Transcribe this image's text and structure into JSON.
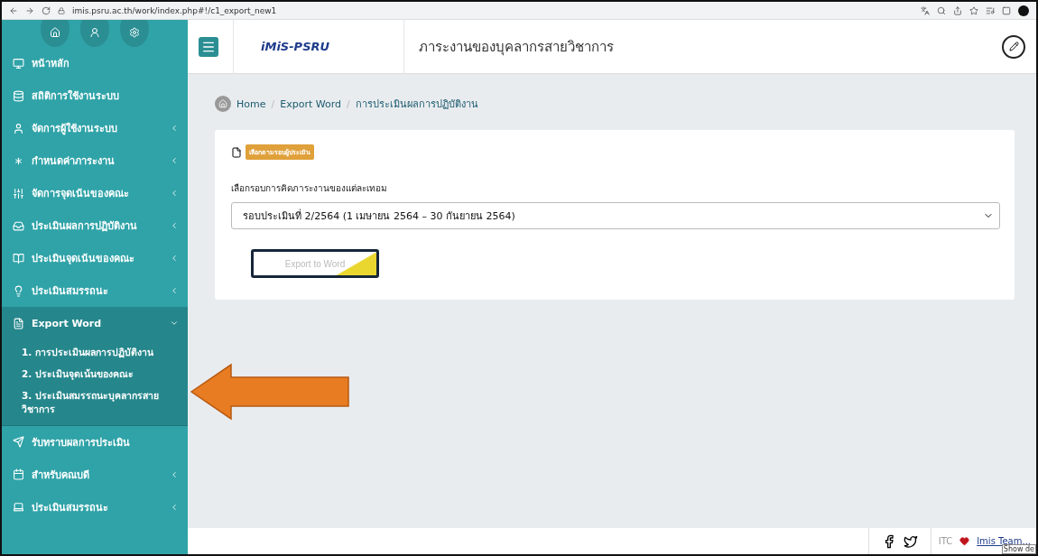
{
  "browser": {
    "url": "imis.psru.ac.th/work/index.php#!/c1_export_new1"
  },
  "sidebar": {
    "items": [
      {
        "label": "หน้าหลัก",
        "kind": "link"
      },
      {
        "label": "สถิติการใช้งานระบบ",
        "kind": "link"
      },
      {
        "label": "จัดการผู้ใช้งานระบบ",
        "kind": "menu",
        "expanded": false
      },
      {
        "label": "กำหนดค่าภาระงาน",
        "kind": "menu",
        "expanded": false
      },
      {
        "label": "จัดการจุดเน้นของคณะ",
        "kind": "menu",
        "expanded": false
      },
      {
        "label": "ประเมินผลการปฏิบัติงาน",
        "kind": "menu",
        "expanded": false
      },
      {
        "label": "ประเมินจุดเน้นของคณะ",
        "kind": "menu",
        "expanded": false
      },
      {
        "label": "ประเมินสมรรถนะ",
        "kind": "menu",
        "expanded": false
      },
      {
        "label": "Export Word",
        "kind": "menu",
        "expanded": true,
        "children": [
          {
            "label": "1. การประเมินผลการปฏิบัติงาน"
          },
          {
            "label": "2. ประเมินจุดเน้นของคณะ"
          },
          {
            "label": "3. ประเมินสมรรถนะบุคลากรสายวิชาการ"
          }
        ]
      },
      {
        "label": "รับทราบผลการประเมิน",
        "kind": "link"
      },
      {
        "label": "สำหรับคณบดี",
        "kind": "menu",
        "expanded": false
      },
      {
        "label": "ประเมินสมรรถนะ",
        "kind": "menu",
        "expanded": false
      }
    ]
  },
  "header": {
    "logo": "iMiS-PSRU",
    "title": "ภาระงานของบุคลากรสายวิชาการ"
  },
  "breadcrumb": {
    "separator": "/",
    "items": [
      "Home",
      "Export Word",
      "การประเมินผลการปฏิบัติงาน"
    ]
  },
  "card": {
    "badge": "เลือกตามรอบผู้ประเมิน",
    "field_label": "เลือกรอบการคิดภาระงานของแต่ละเทอม",
    "select_value": "รอบประเมินที่ 2/2564 (1 เมษายน 2564 – 30 กันยายน 2564)",
    "export_button": "Export to Word"
  },
  "footer": {
    "credit_prefix": "ITC",
    "credit_team": "Imis Team...",
    "tooltip": "Show de"
  }
}
